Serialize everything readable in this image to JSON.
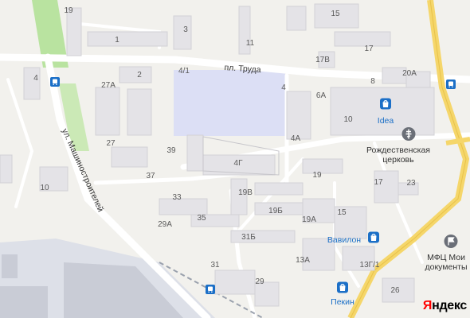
{
  "colors": {
    "background": "#f2f1ed",
    "building": "#e4e3e7",
    "building_stroke": "#d2d1d6",
    "road": "#ffffff",
    "main_road": "#f5d66a",
    "green": "#b9e3a0",
    "selected_area": "#dcdff5",
    "industrial": "#c9ccd6",
    "poi_blue": "#1b6fc7",
    "transit_blue": "#1b6fc7"
  },
  "streets": {
    "trud": "пл. Труда",
    "mashinostroiteley": "ул. Машиностроителей"
  },
  "house_numbers": [
    "19",
    "15",
    "3",
    "11",
    "17",
    "1",
    "17В",
    "4/1",
    "2",
    "27А",
    "8",
    "20А",
    "4",
    "4",
    "6А",
    "10",
    "4А",
    "27",
    "39",
    "4Г",
    "37",
    "19",
    "10",
    "17",
    "23",
    "33",
    "19В",
    "29А",
    "35",
    "19Б",
    "19А",
    "15",
    "31Б",
    "13А",
    "13Г/1",
    "31",
    "29",
    "26"
  ],
  "pois": {
    "ideas": "Idea",
    "church": "Рождественская церковь",
    "vavilon": "Вавилон",
    "pekin": "Пекин",
    "mfc": "МФЦ Мои документы"
  },
  "icons": {
    "shop": "shopping-bag-icon",
    "church": "orthodox-cross-icon",
    "government": "flag-icon",
    "bus_stop": "bus-stop-icon"
  },
  "logo": {
    "part1": "Я",
    "part2": "ндекс"
  }
}
